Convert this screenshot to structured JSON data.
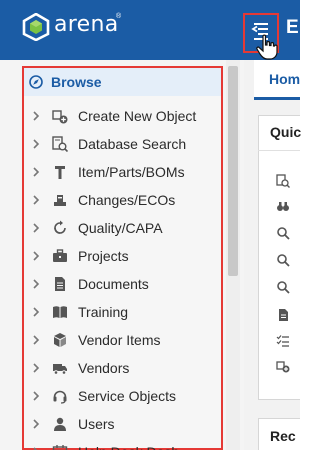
{
  "header": {
    "brand": "arena",
    "brand_mark": "®",
    "cut_label": "E",
    "logo_icon": "arena-logo-icon",
    "menu_icon": "menu-toggle-icon",
    "accent": "#1b5ca5"
  },
  "sidebar": {
    "browse_label": "Browse",
    "items": [
      {
        "label": "Create New Object",
        "icon": "create-object-icon"
      },
      {
        "label": "Database Search",
        "icon": "database-search-icon"
      },
      {
        "label": "Item/Parts/BOMs",
        "icon": "item-parts-icon"
      },
      {
        "label": "Changes/ECOs",
        "icon": "changes-icon"
      },
      {
        "label": "Quality/CAPA",
        "icon": "quality-icon"
      },
      {
        "label": "Projects",
        "icon": "briefcase-icon"
      },
      {
        "label": "Documents",
        "icon": "document-icon"
      },
      {
        "label": "Training",
        "icon": "book-icon"
      },
      {
        "label": "Vendor Items",
        "icon": "boxes-icon"
      },
      {
        "label": "Vendors",
        "icon": "truck-icon"
      },
      {
        "label": "Service Objects",
        "icon": "headset-icon"
      },
      {
        "label": "Users",
        "icon": "users-icon"
      },
      {
        "label": "Help Desk Dash",
        "icon": "calendar-icon"
      }
    ]
  },
  "main": {
    "home_tab": "Hom",
    "quick_title": "Quic",
    "recent_title": "Rec"
  }
}
